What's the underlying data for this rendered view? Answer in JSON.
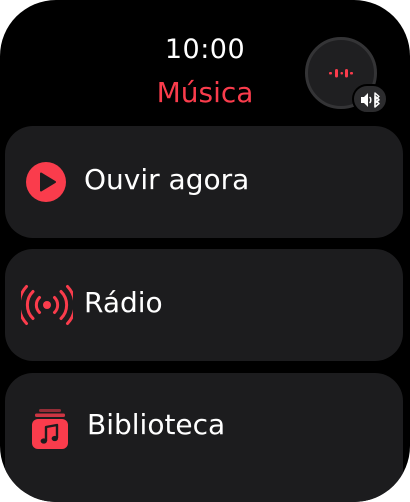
{
  "status": {
    "time": "10:00"
  },
  "app": {
    "title": "Música"
  },
  "now_playing": {
    "icon": "waveform-icon"
  },
  "audio_output": {
    "icon": "speaker-bluetooth-icon"
  },
  "menu": {
    "items": [
      {
        "label": "Ouvir agora",
        "icon": "play-circle-icon"
      },
      {
        "label": "Rádio",
        "icon": "radio-broadcast-icon"
      },
      {
        "label": "Biblioteca",
        "icon": "library-music-icon"
      }
    ]
  },
  "colors": {
    "accent": "#fa3c4c",
    "background": "#000000",
    "card": "#1c1c1e"
  }
}
